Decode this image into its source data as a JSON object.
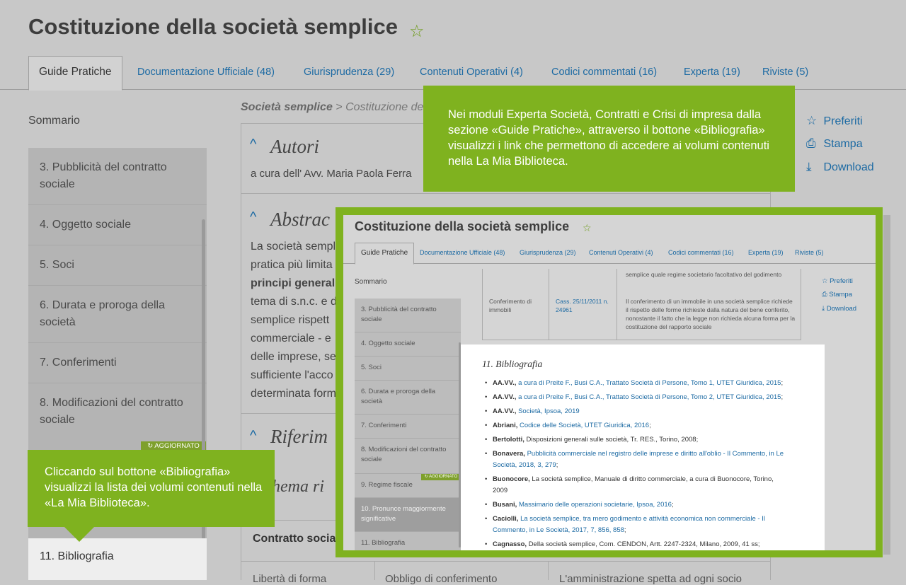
{
  "page": {
    "title": "Costituzione della società semplice",
    "star_icon": "★"
  },
  "tabs": [
    {
      "label": "Guide Pratiche"
    },
    {
      "label": "Documentazione Ufficiale (48)"
    },
    {
      "label": "Giurisprudenza (29)"
    },
    {
      "label": "Contenuti Operativi (4)"
    },
    {
      "label": "Codici commentati (16)"
    },
    {
      "label": "Experta (19)"
    },
    {
      "label": "Riviste (5)"
    }
  ],
  "sidebar": {
    "heading": "Sommario",
    "items": [
      {
        "label": "3. Pubblicità del contratto sociale"
      },
      {
        "label": "4. Oggetto sociale"
      },
      {
        "label": "5. Soci"
      },
      {
        "label": "6. Durata e proroga della società"
      },
      {
        "label": "7. Conferimenti"
      },
      {
        "label": "8. Modificazioni del contratto sociale"
      },
      {
        "label": "11. Bibliografia"
      }
    ],
    "badge": "AGGIORNATO"
  },
  "breadcrumb": {
    "root": "Società semplice",
    "sep": " > ",
    "current": "Costituzione dell"
  },
  "content": {
    "autori_heading": "Autori",
    "autori_text": "a cura dell' Avv. Maria Paola Ferra",
    "abstract_heading": "Abstrac",
    "abstract_lines": [
      "La società sempl",
      "pratica più limita",
      "principi generali",
      "tema di s.n.c. e d",
      "semplice rispett",
      "commerciale - e",
      "delle imprese, se",
      "sufficiente l'acco",
      "determinata form"
    ],
    "riferimenti_heading": "Riferim",
    "schema_heading": "hema ri",
    "table_header": "Contratto socia",
    "table_row": [
      "Libertà di forma",
      "Obbligo di conferimento",
      "L'amministrazione spetta ad ogni socio"
    ],
    "caret": "^"
  },
  "tools": [
    {
      "label": "Preferiti",
      "icon": "☆"
    },
    {
      "label": "Stampa",
      "icon": "⎙"
    },
    {
      "label": "Download",
      "icon": "⤓"
    }
  ],
  "callouts": {
    "top": "Nei moduli Experta Società, Contratti e Crisi di impresa dalla sezione «Guide Pratiche», attraverso il bottone «Bibliografia» visualizzi i link che permettono di accedere ai volumi contenuti nella La Mia Biblioteca.",
    "left": "Cliccando sul bottone «Bibliografia» visualizzi la lista dei volumi contenuti nella «La Mia Biblioteca»."
  },
  "inset": {
    "title": "Costituzione della società semplice",
    "tabs": [
      "Guide Pratiche",
      "Documentazione Ufficiale (48)",
      "Giurisprudenza (29)",
      "Contenuti Operativi (4)",
      "Codici commentati (16)",
      "Experta (19)",
      "Riviste (5)"
    ],
    "sommario": "Sommario",
    "sidebar": [
      "3. Pubblicità del contratto sociale",
      "4. Oggetto sociale",
      "5. Soci",
      "6. Durata e proroga della società",
      "7. Conferimenti",
      "8. Modificazioni del contratto sociale",
      "9. Regime fiscale",
      "10. Pronunce maggiormente significative",
      "11. Bibliografia"
    ],
    "badge": "AGGIORNATO",
    "table": {
      "top_fragment": "semplice quale regime societario facoltativo del godimento collettivo",
      "col1": "Conferimento di immobili",
      "col2": "Cass. 25/11/2011 n. 24961",
      "col3": "Il conferimento di un immobile in una società semplice richiede il rispetto delle forme richieste dalla natura del bene conferito, nonostante il fatto che la legge non richieda alcuna forma per la costituzione del rapporto sociale"
    },
    "tools": [
      "Preferiti",
      "Stampa",
      "Download"
    ],
    "bibliography_title": "11. Bibliografia",
    "bibliography": [
      {
        "name": "AA.VV.,",
        "link": "a cura di Preite F., Busi C.A., Trattato Società di Persone, Tomo 1, UTET Giuridica, 2015",
        "tail": ";"
      },
      {
        "name": "AA.VV.,",
        "link": "a cura di Preite F., Busi C.A., Trattato Società di Persone, Tomo 2, UTET Giuridica, 2015",
        "tail": ";"
      },
      {
        "name": "AA.VV.,",
        "link": "Società, Ipsoa, 2019",
        "tail": ""
      },
      {
        "name": "Abriani,",
        "link": "Codice delle Società, UTET Giuridica, 2016",
        "tail": ";"
      },
      {
        "name": "Bertolotti,",
        "link": "",
        "tail": "Disposizioni generali sulle società, Tr. RES., Torino, 2008;"
      },
      {
        "name": "Bonavera,",
        "link": "Pubblicità commerciale nel registro delle imprese e diritto all'oblio - Il Commento, in Le Società, 2018, 3, 279",
        "tail": ";"
      },
      {
        "name": "Buonocore,",
        "link": "",
        "tail": "La società semplice, Manuale di diritto commerciale, a cura di Buonocore, Torino, 2009"
      },
      {
        "name": "Busani,",
        "link": "Massimario delle operazioni societarie, Ipsoa, 2016",
        "tail": ";"
      },
      {
        "name": "Caciolli,",
        "link": "La società semplice, tra mero godimento e attività economica non commerciale - Il Commento, in Le Società, 2017, 7, 856, 858",
        "tail": ";"
      },
      {
        "name": "Cagnasso,",
        "link": "",
        "tail": "Della società semplice, Com. CENDON, Artt. 2247-2324, Milano, 2009, 41 ss;"
      }
    ]
  }
}
